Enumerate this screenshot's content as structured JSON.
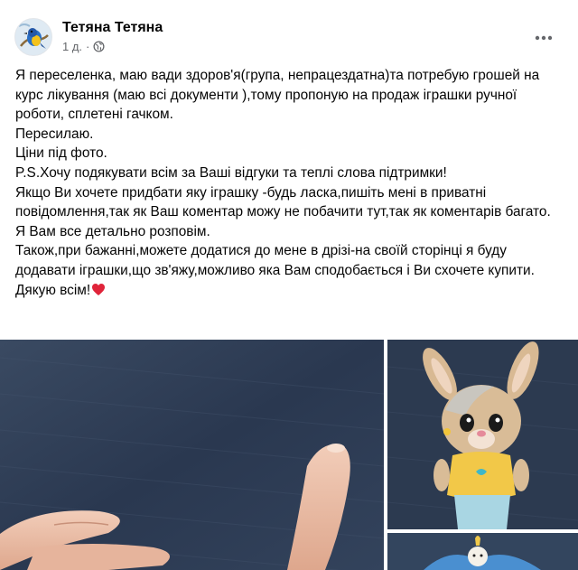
{
  "post": {
    "author": "Тетяна Тетяна",
    "time": "1 д.",
    "separator": "·",
    "privacy_icon": "globe-icon",
    "more_icon": "more-horizontal-icon",
    "paragraphs": [
      "Я переселенка, маю вади здоров'я(група, непрацездатна)та потребую грошей на курс лікування (маю всі документи ),тому пропоную на продаж іграшки ручної роботи, сплетені гачком.",
      "Пересилаю.",
      "Ціни під фото.",
      "P.S.Хочу подякувати всім за Ваші відгуки та теплі слова підтримки!",
      "Якщо Ви хочете придбати яку іграшку -будь ласка,пишіть мені в приватні повідомлення,так як Ваш коментар можу не побачити тут,так як коментарів багато.",
      "Я Вам все детально розповім.",
      "Також,при бажанні,можете додатися до мене в дрізі-на своїй сторінці я буду додавати іграшки,що зв'яжу,можливо яка  Вам сподобається і Ви схочете купити.",
      "Дякую всім!"
    ],
    "heart_icon": "red-heart-emoji-icon",
    "photos": [
      "hand-photo",
      "crochet-bunny-photo",
      "crochet-chick-photo"
    ]
  },
  "colors": {
    "text_primary": "#050505",
    "text_secondary": "#65676b",
    "heart": "#e0243a",
    "background": "#ffffff"
  }
}
